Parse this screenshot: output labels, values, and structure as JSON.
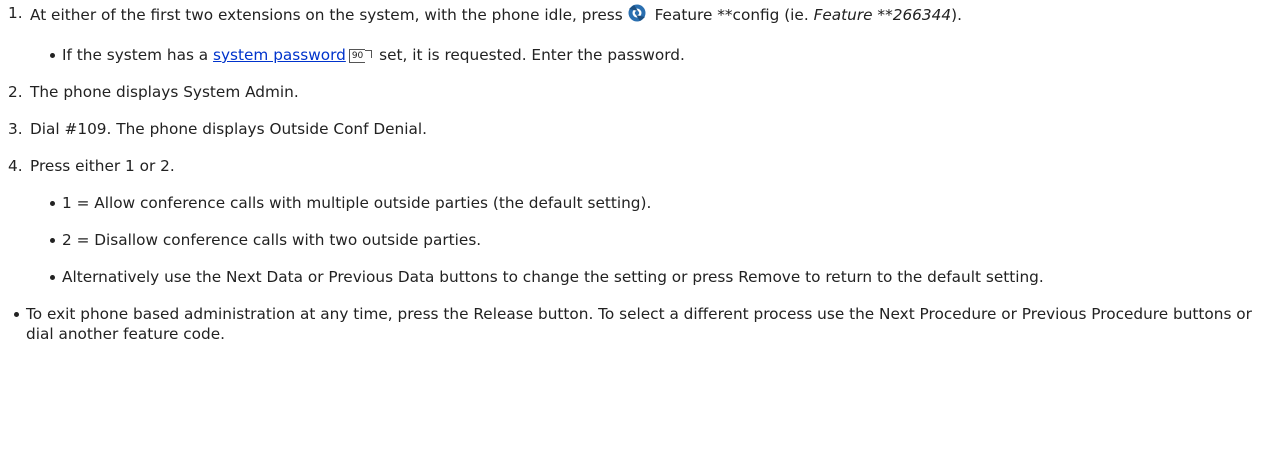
{
  "steps": {
    "s1": {
      "num": "1.",
      "pre": "At either of the first two extensions on the system, with the phone idle, press",
      "mid": " Feature **config (ie. ",
      "ital": "Feature **266344",
      "end": ").",
      "icon": "feature-key-icon",
      "sub": {
        "pre": "If the system has a ",
        "link": "system password",
        "ref": "90",
        "post": " set, it is requested. Enter the password."
      }
    },
    "s2": {
      "num": "2.",
      "text": "The phone displays System Admin."
    },
    "s3": {
      "num": "3.",
      "text": "Dial #109. The phone displays Outside Conf Denial."
    },
    "s4": {
      "num": "4.",
      "text": "Press either 1 or 2.",
      "sub": [
        "1 = Allow conference calls with multiple outside parties (the default setting).",
        "2 = Disallow conference calls with two outside parties.",
        "Alternatively use the Next Data or Previous Data buttons to change the setting or press Remove to return to the default setting."
      ]
    }
  },
  "note": "To exit phone based administration at any time, press the Release button. To select a different process use the Next Procedure or Previous Procedure buttons or dial another feature code.",
  "colors": {
    "text": "#222222",
    "link": "#0033cc",
    "icon": "#2a6fb0"
  }
}
